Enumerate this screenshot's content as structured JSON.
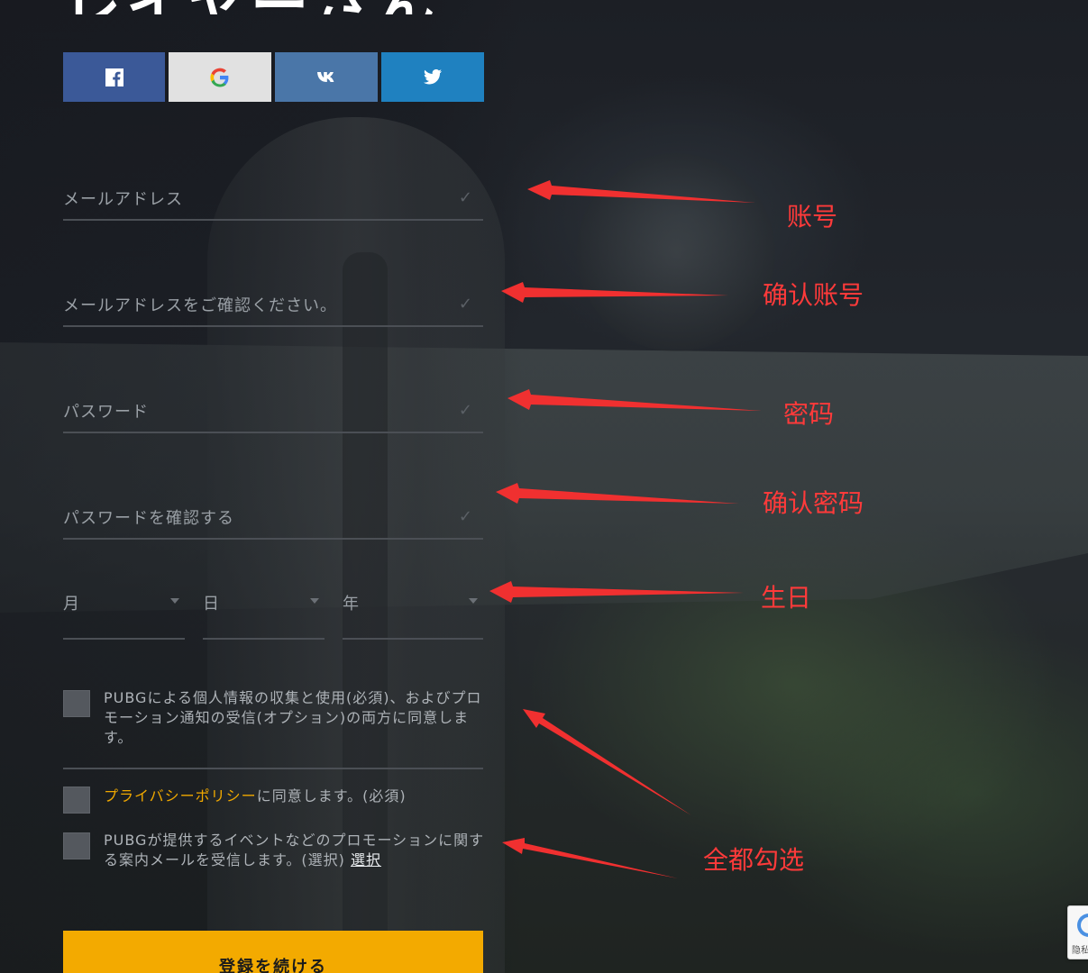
{
  "hero_title": "レイヤーさん",
  "social": {
    "facebook_icon": "facebook-icon",
    "google_icon": "google-icon",
    "vk_icon": "vk-icon",
    "twitter_icon": "twitter-icon"
  },
  "form": {
    "email_placeholder": "メールアドレス",
    "email_confirm_placeholder": "メールアドレスをご確認ください。",
    "password_placeholder": "パスワード",
    "password_confirm_placeholder": "パスワードを確認する",
    "check_mark": "✓",
    "birth_month": "月",
    "birth_day": "日",
    "birth_year": "年",
    "consent1_text": "PUBGによる個人情報の収集と使用(必須)、およびプロモーション通知の受信(オプション)の両方に同意します。",
    "privacy_link": "プライバシーポリシー",
    "privacy_suffix": "に同意します。(必須)",
    "promo_text": "PUBGが提供するイベントなどのプロモーションに関する案内メールを受信します。(選択) ",
    "promo_link": "選択",
    "submit_label": "登録を続ける"
  },
  "annotations": {
    "account": "账号",
    "confirm_account": "确认账号",
    "password": "密码",
    "confirm_password": "确认密码",
    "birthday": "生日",
    "check_all": "全都勾选"
  },
  "recaptcha_text": "隐私权"
}
